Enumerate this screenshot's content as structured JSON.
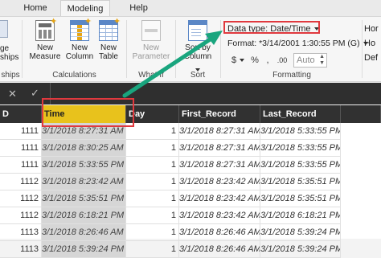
{
  "tabs": [
    {
      "label": "Home"
    },
    {
      "label": "Modeling"
    },
    {
      "label": "Help"
    }
  ],
  "ribbon": {
    "leftpart": {
      "label_top": "ge",
      "label_bottom": "ships",
      "group_label": "ships"
    },
    "calculations": {
      "group_label": "Calculations",
      "new_measure": [
        "New",
        "Measure"
      ],
      "new_column": [
        "New",
        "Column"
      ],
      "new_table": [
        "New",
        "Table"
      ]
    },
    "whatif": {
      "group_label": "What If",
      "new_parameter": [
        "New",
        "Parameter"
      ]
    },
    "sort": {
      "group_label": "Sort",
      "sort_by_column": [
        "Sort by",
        "Column"
      ]
    },
    "formatting": {
      "group_label": "Formatting",
      "data_type": "Data type: Date/Time",
      "format": "Format: *3/14/2001 1:30:55 PM (G)",
      "currency_symbol": "$",
      "percent_symbol": "%",
      "comma_symbol": ",",
      "decimal_symbol": ".00",
      "auto": "Auto"
    },
    "right_cut": {
      "line1": "Hor",
      "line2": "Ho",
      "line3": "Def"
    }
  },
  "grid": {
    "columns": [
      "D",
      "Time",
      "Day",
      "First_Record",
      "Last_Record"
    ],
    "rows": [
      {
        "id": "1111",
        "time": "3/1/2018 8:27:31 AM",
        "day": "1",
        "first": "3/1/2018 8:27:31 AM",
        "last": "3/1/2018 5:33:55 PM"
      },
      {
        "id": "1111",
        "time": "3/1/2018 8:30:25 AM",
        "day": "1",
        "first": "3/1/2018 8:27:31 AM",
        "last": "3/1/2018 5:33:55 PM"
      },
      {
        "id": "1111",
        "time": "3/1/2018 5:33:55 PM",
        "day": "1",
        "first": "3/1/2018 8:27:31 AM",
        "last": "3/1/2018 5:33:55 PM"
      },
      {
        "id": "1112",
        "time": "3/1/2018 8:23:42 AM",
        "day": "1",
        "first": "3/1/2018 8:23:42 AM",
        "last": "3/1/2018 5:35:51 PM"
      },
      {
        "id": "1112",
        "time": "3/1/2018 5:35:51 PM",
        "day": "1",
        "first": "3/1/2018 8:23:42 AM",
        "last": "3/1/2018 5:35:51 PM"
      },
      {
        "id": "1112",
        "time": "3/1/2018 6:18:21 PM",
        "day": "1",
        "first": "3/1/2018 8:23:42 AM",
        "last": "3/1/2018 6:18:21 PM"
      },
      {
        "id": "1113",
        "time": "3/1/2018 8:26:46 AM",
        "day": "1",
        "first": "3/1/2018 8:26:46 AM",
        "last": "3/1/2018 5:39:24 PM"
      },
      {
        "id": "1113",
        "time": "3/1/2018 5:39:24 PM",
        "day": "1",
        "first": "3/1/2018 8:26:46 AM",
        "last": "3/1/2018 5:39:24 PM"
      }
    ]
  }
}
